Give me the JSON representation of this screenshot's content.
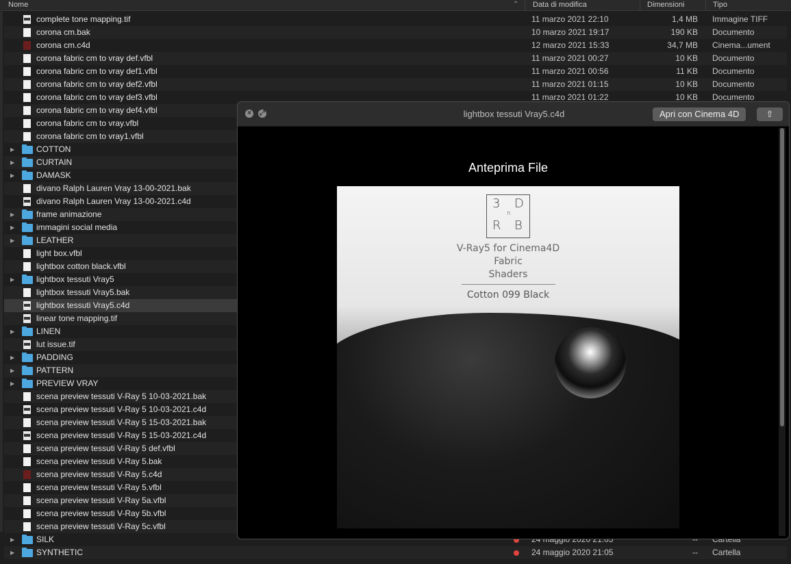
{
  "columns": {
    "name": "Nome",
    "date": "Data di modifica",
    "size": "Dimensioni",
    "kind": "Tipo"
  },
  "rows": [
    {
      "name": "complete tone mapping.tif",
      "icon": "image-file-icon",
      "date": "11 marzo 2021 22:10",
      "size": "1,4 MB",
      "kind": "Immagine TIFF"
    },
    {
      "name": "corona cm.bak",
      "icon": "document-icon",
      "date": "10 marzo 2021 19:17",
      "size": "190 KB",
      "kind": "Documento"
    },
    {
      "name": "corona cm.c4d",
      "icon": "cinema4d-file-icon",
      "date": "12 marzo 2021 15:33",
      "size": "34,7 MB",
      "kind": "Cinema...ument"
    },
    {
      "name": "corona fabric cm to vray def.vfbl",
      "icon": "document-icon",
      "date": "11 marzo 2021 00:27",
      "size": "10 KB",
      "kind": "Documento"
    },
    {
      "name": "corona fabric cm to vray def1.vfbl",
      "icon": "document-icon",
      "date": "11 marzo 2021 00:56",
      "size": "11 KB",
      "kind": "Documento"
    },
    {
      "name": "corona fabric cm to vray def2.vfbl",
      "icon": "document-icon",
      "date": "11 marzo 2021 01:15",
      "size": "10 KB",
      "kind": "Documento"
    },
    {
      "name": "corona fabric cm to vray def3.vfbl",
      "icon": "document-icon",
      "date": "11 marzo 2021 01:22",
      "size": "10 KB",
      "kind": "Documento"
    },
    {
      "name": "corona fabric cm to vray def4.vfbl",
      "icon": "document-icon"
    },
    {
      "name": "corona fabric cm to vray.vfbl",
      "icon": "document-icon"
    },
    {
      "name": "corona fabric cm to vray1.vfbl",
      "icon": "document-icon"
    },
    {
      "name": "COTTON",
      "icon": "folder-icon",
      "folder": true
    },
    {
      "name": "CURTAIN",
      "icon": "folder-icon",
      "folder": true
    },
    {
      "name": "DAMASK",
      "icon": "folder-icon",
      "folder": true
    },
    {
      "name": "divano Ralph Lauren Vray 13-00-2021.bak",
      "icon": "document-icon"
    },
    {
      "name": "divano Ralph Lauren Vray 13-00-2021.c4d",
      "icon": "image-file-icon"
    },
    {
      "name": "frame animazione",
      "icon": "folder-icon",
      "folder": true
    },
    {
      "name": "immagini social media",
      "icon": "folder-icon",
      "folder": true
    },
    {
      "name": "LEATHER",
      "icon": "folder-icon",
      "folder": true
    },
    {
      "name": "light box.vfbl",
      "icon": "document-icon"
    },
    {
      "name": "lightbox cotton black.vfbl",
      "icon": "document-icon"
    },
    {
      "name": "lightbox tessuti Vray5",
      "icon": "folder-icon",
      "folder": true
    },
    {
      "name": "lightbox tessuti Vray5.bak",
      "icon": "document-icon"
    },
    {
      "name": "lightbox tessuti Vray5.c4d",
      "icon": "image-file-icon",
      "selected": true
    },
    {
      "name": "linear tone mapping.tif",
      "icon": "image-file-icon"
    },
    {
      "name": "LINEN",
      "icon": "folder-icon",
      "folder": true
    },
    {
      "name": "lut issue.tif",
      "icon": "image-file-icon"
    },
    {
      "name": "PADDING",
      "icon": "folder-icon",
      "folder": true
    },
    {
      "name": "PATTERN",
      "icon": "folder-icon",
      "folder": true
    },
    {
      "name": "PREVIEW VRAY",
      "icon": "folder-icon",
      "folder": true
    },
    {
      "name": "scena preview tessuti V-Ray 5 10-03-2021.bak",
      "icon": "document-icon"
    },
    {
      "name": "scena preview tessuti V-Ray 5 10-03-2021.c4d",
      "icon": "image-file-icon"
    },
    {
      "name": "scena preview tessuti V-Ray 5 15-03-2021.bak",
      "icon": "document-icon"
    },
    {
      "name": "scena preview tessuti V-Ray 5 15-03-2021.c4d",
      "icon": "image-file-icon"
    },
    {
      "name": "scena preview tessuti V-Ray 5 def.vfbl",
      "icon": "document-icon"
    },
    {
      "name": "scena preview tessuti V-Ray 5.bak",
      "icon": "document-icon"
    },
    {
      "name": "scena preview tessuti V-Ray 5.c4d",
      "icon": "cinema4d-file-icon"
    },
    {
      "name": "scena preview tessuti V-Ray 5.vfbl",
      "icon": "document-icon"
    },
    {
      "name": "scena preview tessuti V-Ray 5a.vfbl",
      "icon": "document-icon"
    },
    {
      "name": "scena preview tessuti V-Ray 5b.vfbl",
      "icon": "document-icon"
    },
    {
      "name": "scena preview tessuti V-Ray 5c.vfbl",
      "icon": "document-icon"
    },
    {
      "name": "SILK",
      "icon": "folder-icon",
      "folder": true,
      "date": "24 maggio 2020 21:05",
      "size": "--",
      "kind": "Cartella",
      "tag": true
    },
    {
      "name": "SYNTHETIC",
      "icon": "folder-icon",
      "folder": true,
      "date": "24 maggio 2020 21:05",
      "size": "--",
      "kind": "Cartella",
      "tag": true
    }
  ],
  "quicklook": {
    "title": "lightbox tessuti Vray5.c4d",
    "open_button": "Apri con Cinema 4D",
    "share_icon": "share-icon",
    "preview_label": "Anteprima File",
    "artwork": {
      "logo_chars": [
        "3",
        "D",
        "R",
        "B",
        "n"
      ],
      "line1": "V-Ray5 for Cinema4D",
      "line2": "Fabric",
      "line3": "Shaders",
      "caption": "Cotton 099 Black"
    }
  }
}
